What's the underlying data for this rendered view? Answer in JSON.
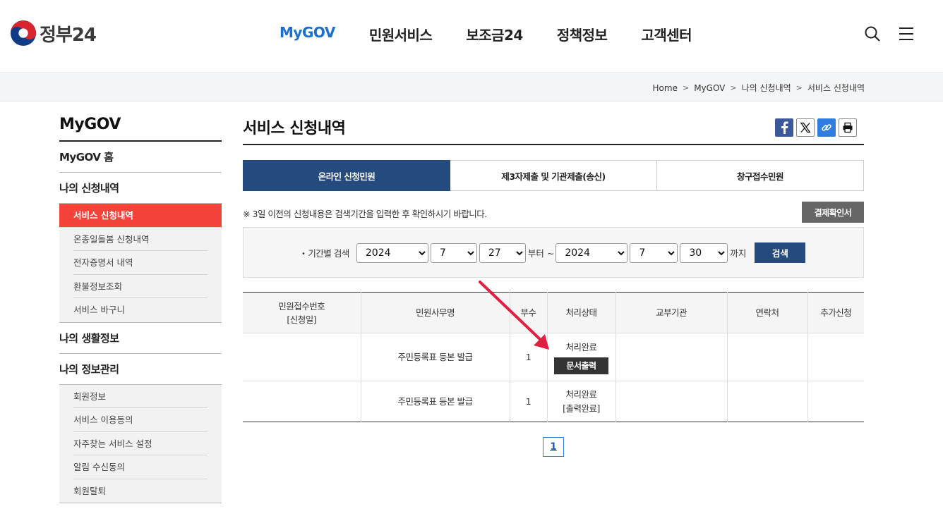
{
  "header": {
    "logo_text": "정부24",
    "nav": [
      "MyGOV",
      "민원서비스",
      "보조금24",
      "정책정보",
      "고객센터"
    ],
    "active_nav": "MyGOV"
  },
  "breadcrumb": [
    "Home",
    "MyGOV",
    "나의 신청내역",
    "서비스 신청내역"
  ],
  "sidebar": {
    "title": "MyGOV",
    "home": "MyGOV 홈",
    "sections": [
      {
        "label": "나의 신청내역",
        "items": [
          "서비스 신청내역",
          "온종일돌봄 신청내역",
          "전자증명서 내역",
          "환불정보조회",
          "서비스 바구니"
        ]
      },
      {
        "label": "나의 생활정보",
        "items": []
      },
      {
        "label": "나의 정보관리",
        "items": [
          "회원정보",
          "서비스 이용동의",
          "자주찾는 서비스 설정",
          "알림 수신동의",
          "회원탈퇴"
        ]
      }
    ]
  },
  "main": {
    "title": "서비스 신청내역",
    "tabs": [
      "온라인 신청민원",
      "제3자제출 및 기관제출(송신)",
      "창구접수민원"
    ],
    "notice": "※ 3일 이전의 신청내용은 검색기간을 입력한 후 확인하시기 바랍니다.",
    "confirm_button": "결제확인서",
    "search": {
      "label": "기간별 검색",
      "dot": "•",
      "from_year": "2024",
      "from_month": "7",
      "from_day": "27",
      "from_text": "부터 ~",
      "to_year": "2024",
      "to_month": "7",
      "to_day": "30",
      "to_text": "까지",
      "button": "검색"
    },
    "table": {
      "headers": [
        "민원접수번호",
        "[신청일]",
        "민원사무명",
        "부수",
        "처리상태",
        "교부기관",
        "연락처",
        "추가신청"
      ],
      "rows": [
        {
          "name": "주민등록표 등본 발급",
          "copies": "1",
          "status": "처리완료",
          "action": "문서출력"
        },
        {
          "name": "주민등록표 등본 발급",
          "copies": "1",
          "status": "처리완료",
          "status_note": "[출력완료]"
        }
      ]
    },
    "page": "1"
  },
  "colors": {
    "accent_blue": "#1c6fcc",
    "tab_active": "#254a7d",
    "sidebar_active": "#f4433b",
    "arrow": "#e02040"
  }
}
